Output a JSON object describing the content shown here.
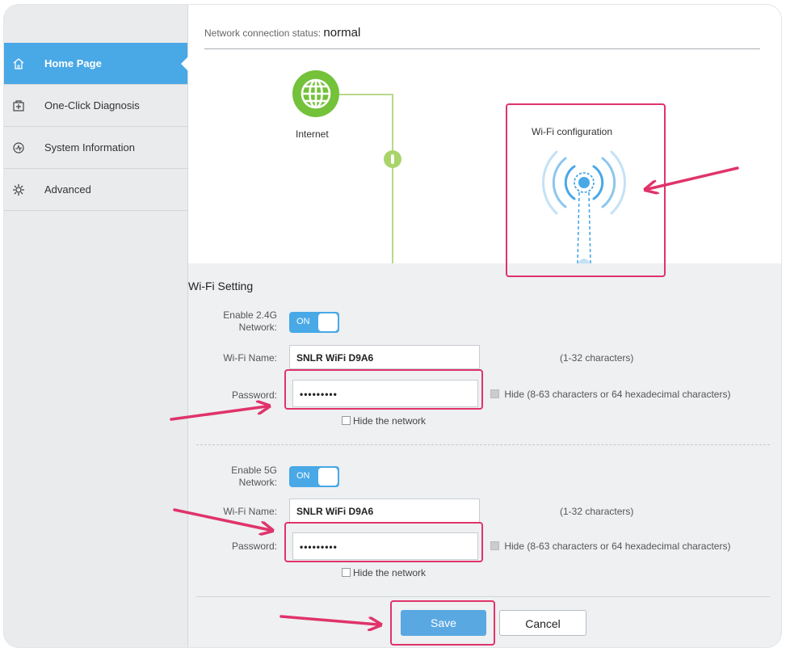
{
  "sidebar": {
    "items": [
      {
        "label": "Home Page",
        "icon": "home-icon",
        "active": true
      },
      {
        "label": "One-Click Diagnosis",
        "icon": "diagnosis-icon"
      },
      {
        "label": "System Information",
        "icon": "system-info-icon"
      },
      {
        "label": "Advanced",
        "icon": "gear-icon"
      }
    ]
  },
  "status": {
    "label": "Network connection status:",
    "value": "normal"
  },
  "topology": {
    "internet_label": "Internet",
    "wifi_config_label": "Wi-Fi configuration"
  },
  "wifi_setting": {
    "title": "Wi-Fi Setting",
    "band_24": {
      "enable_label_1": "Enable 2.4G",
      "enable_label_2": "Network:",
      "toggle": "ON",
      "name_label": "Wi-Fi Name:",
      "name_value": "SNLR WiFi D9A6",
      "name_hint": "(1-32 characters)",
      "password_label": "Password:",
      "password_value": "•••••••••",
      "hide_pw_label": "Hide (8-63 characters or 64 hexadecimal characters)",
      "hide_network_label": "Hide the network"
    },
    "band_5": {
      "enable_label_1": "Enable 5G",
      "enable_label_2": "Network:",
      "toggle": "ON",
      "name_label": "Wi-Fi Name:",
      "name_value": "SNLR WiFi D9A6",
      "name_hint": "(1-32 characters)",
      "password_label": "Password:",
      "password_value": "•••••••••",
      "hide_pw_label": "Hide (8-63 characters or 64 hexadecimal characters)",
      "hide_network_label": "Hide the network"
    }
  },
  "actions": {
    "save": "Save",
    "cancel": "Cancel"
  },
  "colors": {
    "accent": "#49a8e6",
    "highlight": "#e0336a",
    "internet_green": "#74c13a"
  }
}
